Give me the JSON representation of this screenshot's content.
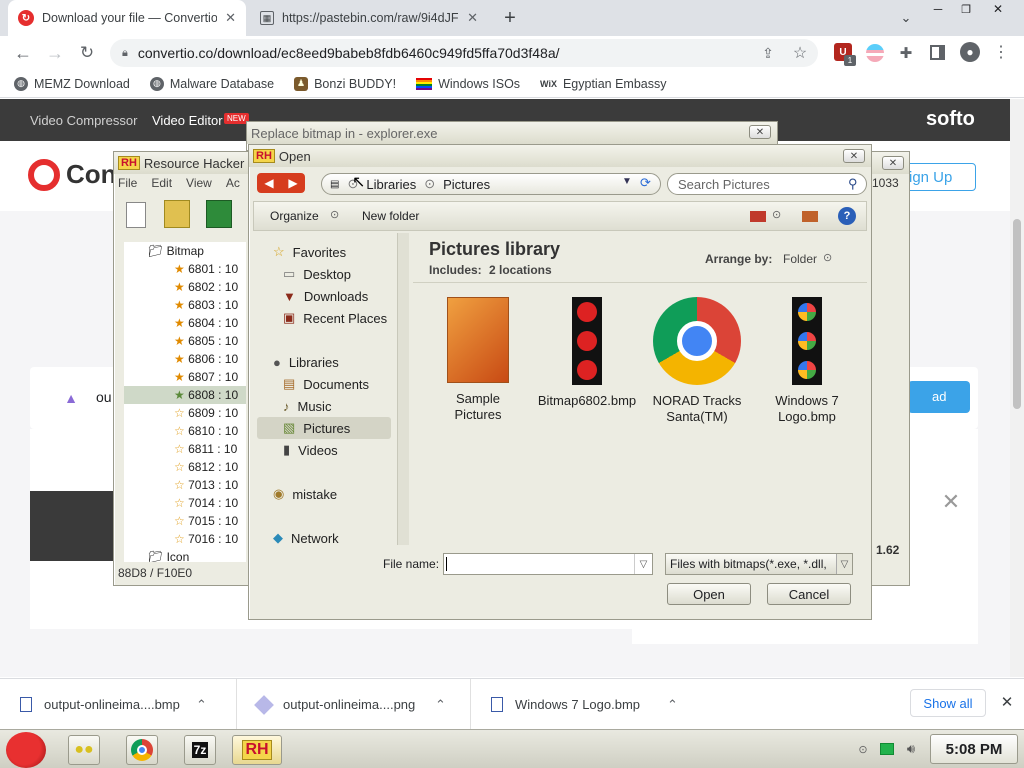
{
  "browser": {
    "tabs": [
      {
        "title": "Download your file — Convertio",
        "active": true
      },
      {
        "title": "https://pastebin.com/raw/9i4dJF",
        "active": false
      }
    ],
    "url": "convertio.co/download/ec8eed9babeb8fdb6460c949fd5ffa70d3f48a/",
    "bookmarks": [
      "MEMZ Download",
      "Malware Database",
      "Bonzi BUDDY!",
      "Windows ISOs",
      "Egyptian Embassy"
    ],
    "extension_badge": "1"
  },
  "site": {
    "nav": [
      "Video Compressor",
      "Video Editor"
    ],
    "new_badge": "NEW",
    "brand_right": "softo",
    "logo_text": "Conv",
    "sign_up": "ign Up",
    "file_label": "ou",
    "download_btn": "ad"
  },
  "rh_window": {
    "title": "Resource Hacker",
    "menu": [
      "File",
      "Edit",
      "View",
      "Ac"
    ],
    "tree_root": "Bitmap",
    "items": [
      "6801 : 10",
      "6802 : 10",
      "6803 : 10",
      "6804 : 10",
      "6805 : 10",
      "6806 : 10",
      "6807 : 10",
      "6808 : 10",
      "6809 : 10",
      "6810 : 10",
      "6811 : 10",
      "6812 : 10",
      "7013 : 10",
      "7014 : 10",
      "7015 : 10",
      "7016 : 10"
    ],
    "tree_next": "Icon",
    "status": "88D8 / F10E0",
    "lang": "1033",
    "version": "1.62"
  },
  "replace_dialog": {
    "title": "Replace bitmap in - explorer.exe"
  },
  "open_dialog": {
    "title": "Open",
    "breadcrumb": [
      "Libraries",
      "Pictures"
    ],
    "search_placeholder": "Search Pictures",
    "organize": "Organize",
    "new_folder": "New folder",
    "nav_groups": [
      {
        "label": "Favorites",
        "items": [
          "Desktop",
          "Downloads",
          "Recent Places"
        ]
      },
      {
        "label": "Libraries",
        "items": [
          "Documents",
          "Music",
          "Pictures",
          "Videos"
        ]
      },
      {
        "label": "mistake",
        "items": []
      },
      {
        "label": "Network",
        "items": []
      }
    ],
    "library_title": "Pictures library",
    "includes_label": "Includes:",
    "includes_value": "2 locations",
    "arrange_label": "Arrange by:",
    "arrange_value": "Folder",
    "files": [
      {
        "name": "Sample Pictures"
      },
      {
        "name": "Bitmap6802.bmp"
      },
      {
        "name": "NORAD Tracks Santa(TM)"
      },
      {
        "name": "Windows 7 Logo.bmp"
      }
    ],
    "file_name_label": "File name:",
    "file_name_value": "",
    "filter": "Files with bitmaps(*.exe, *.dll,",
    "open_btn": "Open",
    "cancel_btn": "Cancel"
  },
  "downloads": [
    {
      "name": "output-onlineima....bmp"
    },
    {
      "name": "output-onlineima....png"
    },
    {
      "name": "Windows 7 Logo.bmp"
    }
  ],
  "show_all": "Show all",
  "clock": "5:08 PM",
  "colors": {
    "chrome_tab_bg": "#dee1e6",
    "taskbar": "#dcdccf",
    "accent_blue": "#1a73e8",
    "convertio_red": "#e52e2e"
  }
}
